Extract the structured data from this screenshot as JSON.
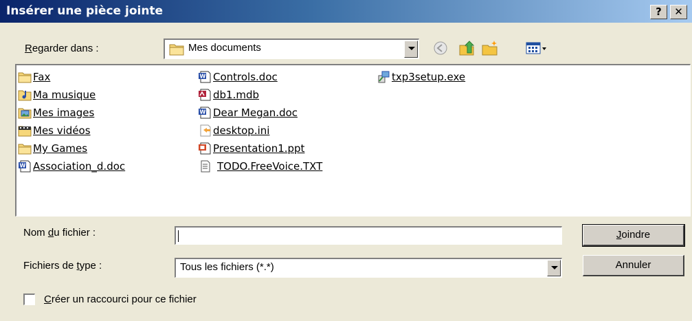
{
  "window": {
    "title": "Insérer une pièce jointe",
    "help_glyph": "?",
    "close_glyph": "✕"
  },
  "look_in": {
    "label_pre": "",
    "label_key": "R",
    "label_post": "egarder dans :",
    "value": "Mes documents",
    "icon": "folder-icon"
  },
  "toolbar": {
    "icons": [
      "back-icon",
      "up-folder-icon",
      "new-folder-icon",
      "view-menu-icon"
    ]
  },
  "files": {
    "col1": [
      {
        "name": "Fax",
        "icon": "folder-icon"
      },
      {
        "name": "Ma musique",
        "icon": "music-folder-icon"
      },
      {
        "name": "Mes images",
        "icon": "pictures-folder-icon"
      },
      {
        "name": "Mes vidéos",
        "icon": "videos-folder-icon"
      },
      {
        "name": "My Games",
        "icon": "folder-icon"
      },
      {
        "name": "Association_d.doc",
        "icon": "word-doc-icon"
      }
    ],
    "col2": [
      {
        "name": "Controls.doc",
        "icon": "word-doc-icon"
      },
      {
        "name": "db1.mdb",
        "icon": "access-db-icon"
      },
      {
        "name": "Dear Megan.doc",
        "icon": "word-doc-icon"
      },
      {
        "name": "desktop.ini",
        "icon": "ini-file-icon"
      },
      {
        "name": "Presentation1.ppt",
        "icon": "powerpoint-icon"
      },
      {
        "name": "TODO.FreeVoice.TXT",
        "icon": "text-file-icon"
      }
    ],
    "col3": [
      {
        "name": "txp3setup.exe",
        "icon": "setup-exe-icon"
      }
    ]
  },
  "filename": {
    "label_pre": "Nom ",
    "label_key": "d",
    "label_post": "u fichier :",
    "value": ""
  },
  "filetype": {
    "label_pre": "Fichiers de ",
    "label_key": "t",
    "label_post": "ype :",
    "value": "Tous les fichiers (*.*)"
  },
  "buttons": {
    "attach_key": "J",
    "attach_rest": "oindre",
    "cancel": "Annuler"
  },
  "shortcut": {
    "label_key": "C",
    "label_rest": "réer un raccourci pour ce fichier",
    "checked": false
  }
}
